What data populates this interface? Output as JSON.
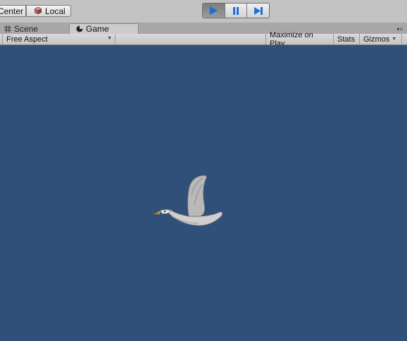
{
  "toolbar": {
    "pivot_center_label": "Center",
    "pivot_local_label": "Local"
  },
  "play_controls": {
    "play_icon": "play-icon",
    "pause_icon": "pause-icon",
    "step_icon": "step-icon",
    "accent_color": "#1f6fd6",
    "play_active": true
  },
  "tabs": [
    {
      "label": "Scene",
      "icon": "grid-icon",
      "active": false
    },
    {
      "label": "Game",
      "icon": "game-controller-icon",
      "active": true
    }
  ],
  "game_controls": {
    "aspect_label": "Free Aspect",
    "maximize_label": "Maximize on Play",
    "stats_label": "Stats",
    "gizmos_label": "Gizmos"
  },
  "game_view": {
    "background_color": "#30507a",
    "sprite": "flying-goose"
  }
}
